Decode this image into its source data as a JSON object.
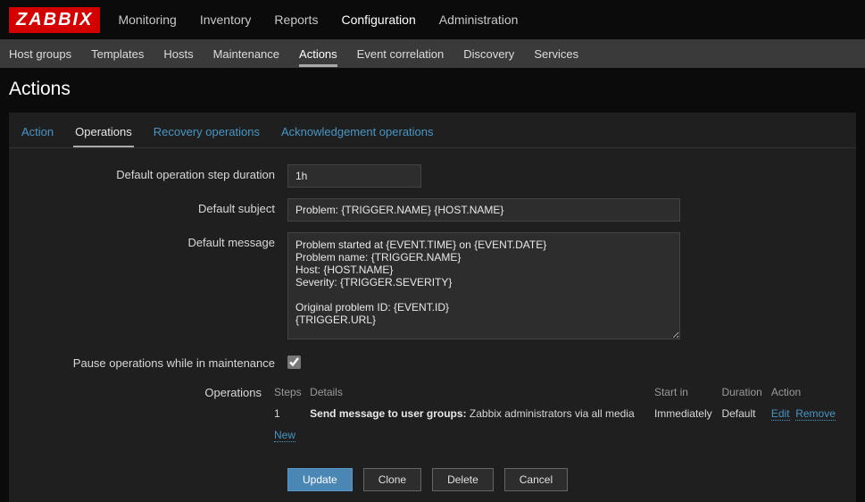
{
  "logo": "ZABBIX",
  "topnav": {
    "monitoring": "Monitoring",
    "inventory": "Inventory",
    "reports": "Reports",
    "configuration": "Configuration",
    "administration": "Administration"
  },
  "subnav": {
    "hostgroups": "Host groups",
    "templates": "Templates",
    "hosts": "Hosts",
    "maintenance": "Maintenance",
    "actions": "Actions",
    "eventcorr": "Event correlation",
    "discovery": "Discovery",
    "services": "Services"
  },
  "page_title": "Actions",
  "tabs": {
    "action": "Action",
    "operations": "Operations",
    "recovery": "Recovery operations",
    "ack": "Acknowledgement operations"
  },
  "labels": {
    "step_duration": "Default operation step duration",
    "default_subject": "Default subject",
    "default_message": "Default message",
    "pause": "Pause operations while in maintenance",
    "operations": "Operations"
  },
  "fields": {
    "step_duration": "1h",
    "default_subject": "Problem: {TRIGGER.NAME} {HOST.NAME}",
    "default_message": "Problem started at {EVENT.TIME} on {EVENT.DATE}\nProblem name: {TRIGGER.NAME}\nHost: {HOST.NAME}\nSeverity: {TRIGGER.SEVERITY}\n\nOriginal problem ID: {EVENT.ID}\n{TRIGGER.URL}",
    "pause_checked": true
  },
  "ops": {
    "headers": {
      "steps": "Steps",
      "details": "Details",
      "startin": "Start in",
      "duration": "Duration",
      "action": "Action"
    },
    "row": {
      "steps": "1",
      "details_prefix": "Send message to user groups:",
      "details_rest": " Zabbix administrators via all media",
      "startin": "Immediately",
      "duration": "Default",
      "edit": "Edit",
      "remove": "Remove"
    },
    "new": "New"
  },
  "buttons": {
    "update": "Update",
    "clone": "Clone",
    "delete": "Delete",
    "cancel": "Cancel"
  }
}
